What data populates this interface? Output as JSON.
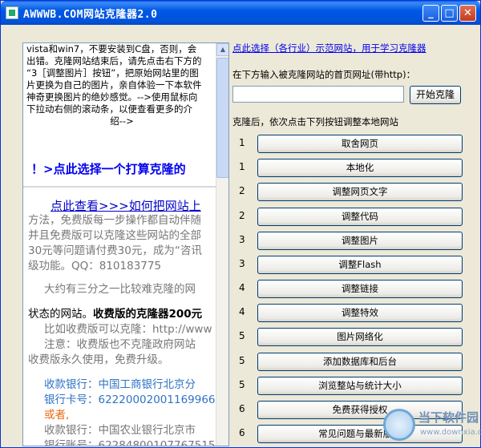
{
  "window": {
    "title": "AWWWB.COM网站克隆器2.0",
    "controls": {
      "minimize": "_",
      "maximize": "□",
      "close": "✕"
    }
  },
  "left_pane": {
    "intro_lines": [
      "vista和win7，不要安装到C盘，否则，会",
      "出错。克隆网站结束后，请先点击右下方的",
      "“3［调整图片］按钮”，把原始网站里的图",
      "片更换为自己的图片，亲自体验一下本软件",
      "神奇更换图片的绝妙感觉。-->使用鼠标向",
      "下拉动右侧的滚动条，以便查看更多的介",
      "绍-->"
    ],
    "big_link": "！>点此选择一个打算克隆的",
    "view_link": "点此查看>>>如何把网站上",
    "grey_lines": [
      "方法，免费版每一步操作都自动伴随",
      "并且免费版可以克隆这些网站的全部",
      "30元等问题请付费30元，成为“咨讯",
      "级功能。QQ：810183775"
    ],
    "grey2": "大约有三分之一比较难克隆的网",
    "black_line_a": "状态的网站。",
    "black_line_b": "收费版的克隆器200元",
    "grey3_lines": [
      "比如收费版可以克隆：http://www",
      "注意：收费版也不克隆政府网站",
      "收费版永久使用，免费升级。"
    ],
    "bank1": "收款银行：中国工商银行北京分",
    "card1": "银行卡号：62220002001169966",
    "or": "或者,",
    "bank2": "收款银行：中国农业银行北京市",
    "card2": "银行账号：62284800107767515"
  },
  "right": {
    "demo_link": "点此选择（各行业）示范网站，用于学习克隆器",
    "input_label": "在下方输入被克隆网站的首页网址(带http)：",
    "url_value": "",
    "start_button": "开始克隆",
    "after_label": "克隆后，依次点击下列按钮调整本地网站",
    "steps": [
      {
        "num": "1",
        "label": "取舍网页"
      },
      {
        "num": "1",
        "label": "本地化"
      },
      {
        "num": "2",
        "label": "调整网页文字"
      },
      {
        "num": "2",
        "label": "调整代码"
      },
      {
        "num": "3",
        "label": "调整图片"
      },
      {
        "num": "3",
        "label": "调整Flash"
      },
      {
        "num": "4",
        "label": "调整链接"
      },
      {
        "num": "4",
        "label": "调整特效"
      },
      {
        "num": "5",
        "label": "图片网络化"
      },
      {
        "num": "5",
        "label": "添加数据库和后台"
      },
      {
        "num": "5",
        "label": "浏览整站与统计大小"
      },
      {
        "num": "6",
        "label": "免费获得授权"
      },
      {
        "num": "6",
        "label": "常见问题与最新版本"
      }
    ]
  },
  "watermark": {
    "name": "当下软件园",
    "url": "www.downxia.com"
  }
}
